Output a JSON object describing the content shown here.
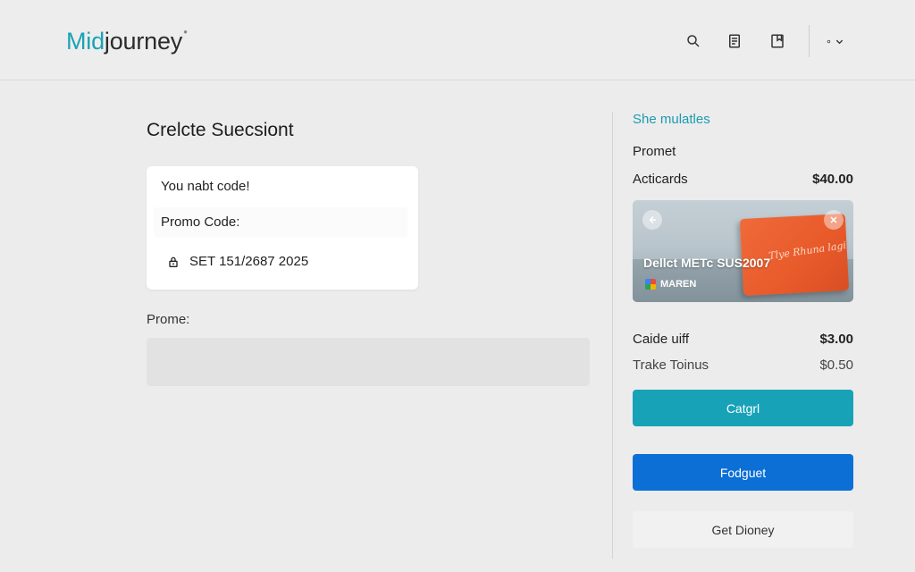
{
  "header": {
    "logo_accent": "Mid",
    "logo_rest": "journey",
    "icons": [
      "search-icon",
      "receipt-icon",
      "bookmark-icon"
    ],
    "account_toggle": "∘"
  },
  "main": {
    "title": "Crelcte Suecsiont",
    "promo_card": {
      "heading": "You nabt code!",
      "code_label": "Promo Code:",
      "code_value": "SET 151/2687 2025"
    },
    "field_label": "Prome:",
    "field_value": "",
    "field_placeholder": ""
  },
  "summary": {
    "link": "She mulatles",
    "section_label": "Promet",
    "item": {
      "label": "Acticards",
      "value": "$40.00"
    },
    "card_image": {
      "overlay_text": "Dellct METc SUS2007",
      "brand_text": "MAREN",
      "script_text": "Tlye Rhuna lagi"
    },
    "lines": [
      {
        "label": "Caide uiff",
        "value": "$3.00"
      },
      {
        "label": "Trake Toinus",
        "value": "$0.50"
      }
    ],
    "buttons": {
      "primary": "Catgrl",
      "secondary": "Fodguet",
      "tertiary": "Get Dioney"
    }
  },
  "colors": {
    "accent": "#19a3b5",
    "teal_button": "#17a2b8",
    "blue_button": "#0b6fd6",
    "card_orange": "#e85a2a"
  }
}
